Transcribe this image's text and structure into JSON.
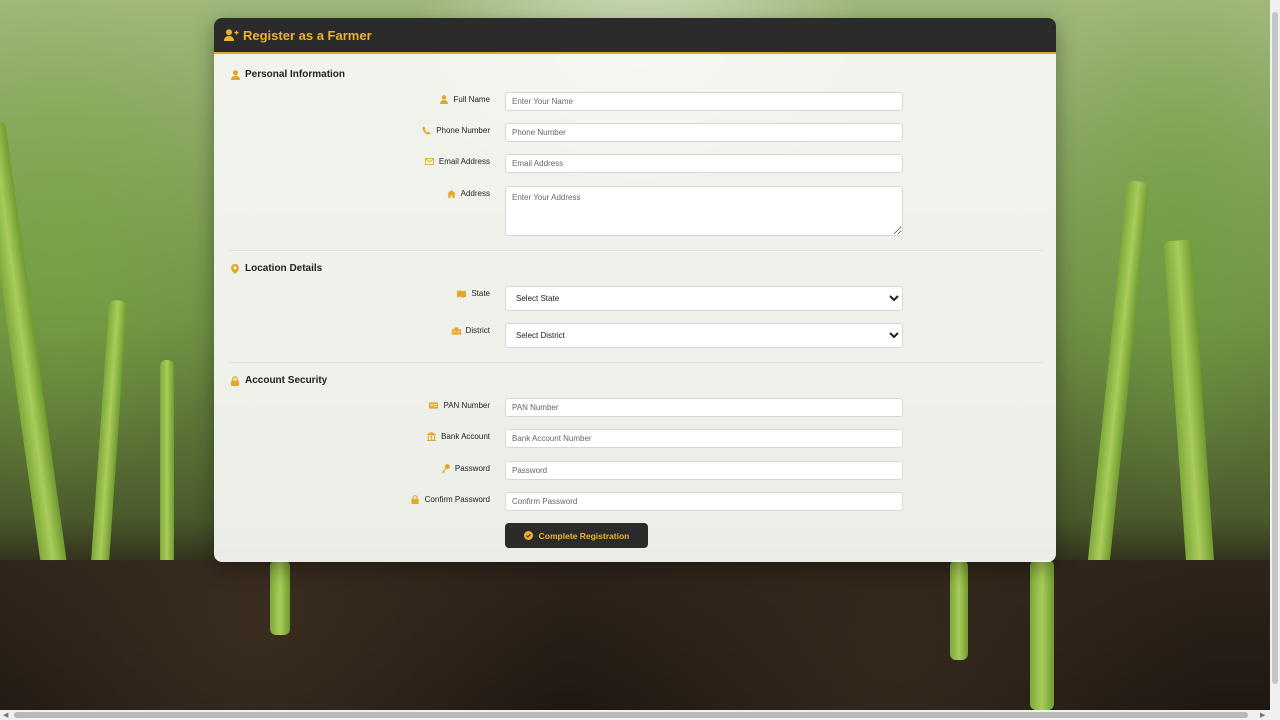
{
  "header": {
    "title": "Register as a Farmer",
    "icon": "user-plus-icon"
  },
  "accent_color": "#e2a82a",
  "sections": {
    "personal": {
      "title": "Personal Information",
      "icon": "user-icon"
    },
    "location": {
      "title": "Location Details",
      "icon": "map-pin-icon"
    },
    "security": {
      "title": "Account Security",
      "icon": "lock-icon"
    }
  },
  "fields": {
    "full_name": {
      "label": "Full Name",
      "placeholder": "Enter Your Name",
      "icon": "user-icon"
    },
    "phone": {
      "label": "Phone Number",
      "placeholder": "Phone Number",
      "icon": "phone-icon"
    },
    "email": {
      "label": "Email Address",
      "placeholder": "Email Address",
      "icon": "envelope-icon"
    },
    "address": {
      "label": "Address",
      "placeholder": "Enter Your Address",
      "icon": "home-icon"
    },
    "state": {
      "label": "State",
      "selected": "Select State",
      "icon": "map-icon"
    },
    "district": {
      "label": "District",
      "selected": "Select District",
      "icon": "building-icon"
    },
    "pan": {
      "label": "PAN Number",
      "placeholder": "PAN Number",
      "icon": "id-card-icon"
    },
    "bank": {
      "label": "Bank Account",
      "placeholder": "Bank Account Number",
      "icon": "bank-icon"
    },
    "password": {
      "label": "Password",
      "placeholder": "Password",
      "icon": "key-icon"
    },
    "confirm_password": {
      "label": "Confirm Password",
      "placeholder": "Confirm Password",
      "icon": "lock-icon"
    }
  },
  "submit": {
    "label": "Complete Registration",
    "icon": "check-circle-icon"
  }
}
